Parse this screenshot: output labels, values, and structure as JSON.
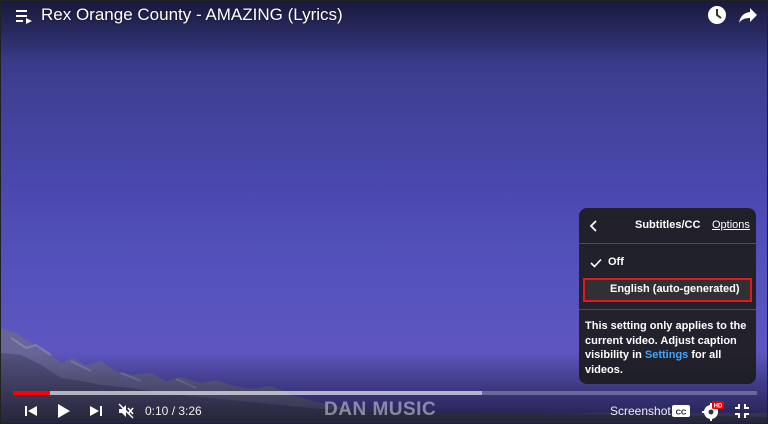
{
  "video": {
    "title": "Rex Orange County - AMAZING (Lyrics)",
    "watermark": "DAN MUSIC",
    "time_current": "0:10",
    "time_separator": " / ",
    "time_total": "3:26",
    "progress_played_fraction": 0.05,
    "progress_buffered_fraction": 0.63
  },
  "icons": {
    "playlist": "playlist-icon",
    "watch_later": "clock-icon",
    "share": "share-arrow-icon",
    "previous": "skip-previous-icon",
    "play": "play-icon",
    "next": "skip-next-icon",
    "mute": "volume-muted-icon",
    "captions": "cc-icon",
    "settings": "gear-hd-icon",
    "exit_fullscreen": "exit-fullscreen-icon"
  },
  "controls": {
    "screenshot_label": "Screenshot",
    "cc_label": "CC",
    "hd_badge": "HD"
  },
  "captions_menu": {
    "title": "Subtitles/CC",
    "options_label": "Options",
    "items": [
      {
        "label": "Off",
        "selected": true
      },
      {
        "label": "English (auto-generated)",
        "selected": false
      }
    ],
    "note_prefix": "This setting only applies to the current video. Adjust caption visibility in ",
    "note_link": "Settings",
    "note_suffix": " for all videos."
  },
  "colors": {
    "progress_red": "#ff0000",
    "highlight_border": "#e8161c",
    "link_blue": "#3ea6ff",
    "menu_bg": "#1c1c1c"
  }
}
